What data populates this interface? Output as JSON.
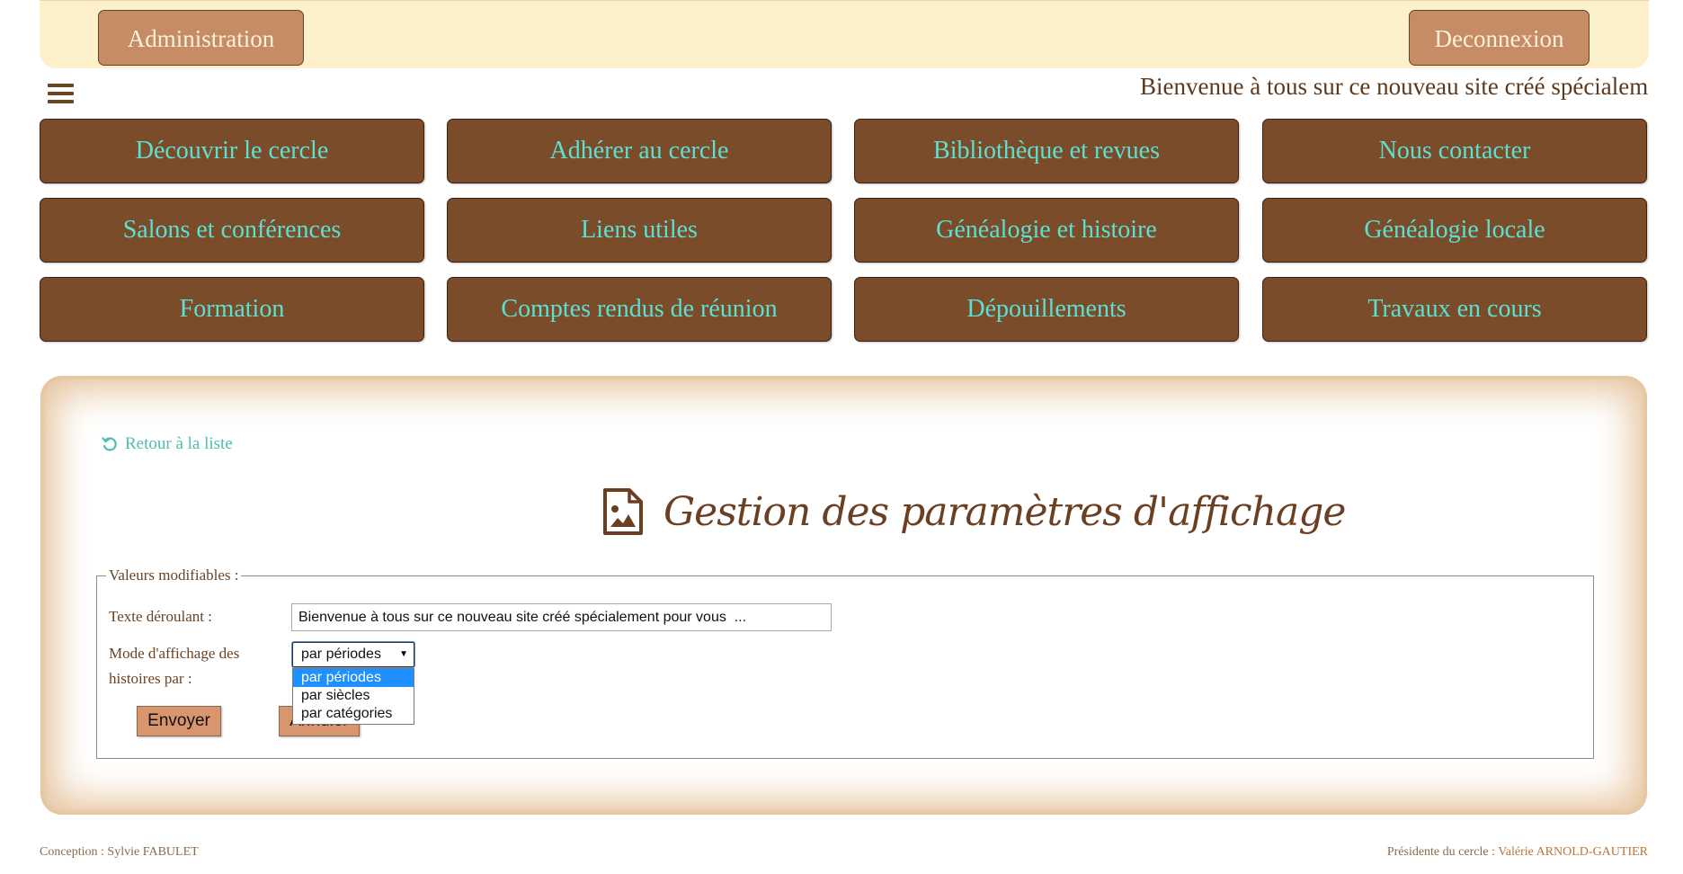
{
  "topbar": {
    "admin_label": "Administration",
    "logout_label": "Deconnexion"
  },
  "marquee": {
    "text": "Bienvenue à tous sur ce nouveau site créé spécialement pour vous"
  },
  "nav": {
    "items": [
      {
        "label": "Découvrir le cercle"
      },
      {
        "label": "Adhérer au cercle"
      },
      {
        "label": "Bibliothèque et revues"
      },
      {
        "label": "Nous contacter"
      },
      {
        "label": "Salons et conférences"
      },
      {
        "label": "Liens utiles"
      },
      {
        "label": "Généalogie et histoire"
      },
      {
        "label": "Généalogie locale"
      },
      {
        "label": "Formation"
      },
      {
        "label": "Comptes rendus de réunion"
      },
      {
        "label": "Dépouillements"
      },
      {
        "label": "Travaux en cours"
      }
    ]
  },
  "main": {
    "back_label": "Retour à la liste",
    "title": "Gestion des paramètres d'affichage",
    "form": {
      "legend": "Valeurs modifiables :",
      "text_label": "Texte déroulant :",
      "text_value": "Bienvenue à tous sur ce nouveau site créé spécialement pour vous  ...",
      "mode_label": "Mode d'affichage des histoires par :",
      "mode_selected": "par périodes",
      "mode_options": [
        "par périodes",
        "par siècles",
        "par catégories"
      ],
      "send_label": "Envoyer",
      "cancel_label": "Annuler"
    }
  },
  "footer": {
    "left": "Conception : Sylvie FABULET",
    "right_prefix": "Présidente du cercle : ",
    "right_name": "Valérie ARNOLD-GAUTIER"
  },
  "colors": {
    "topbar_bg": "#fdf1cc",
    "top_button": "#c68c66",
    "nav_button": "#7b4c2a",
    "nav_text": "#5ce0d2",
    "title_text": "#6b3f22",
    "link": "#4cbfae",
    "dropdown_highlight": "#1e90ff"
  }
}
